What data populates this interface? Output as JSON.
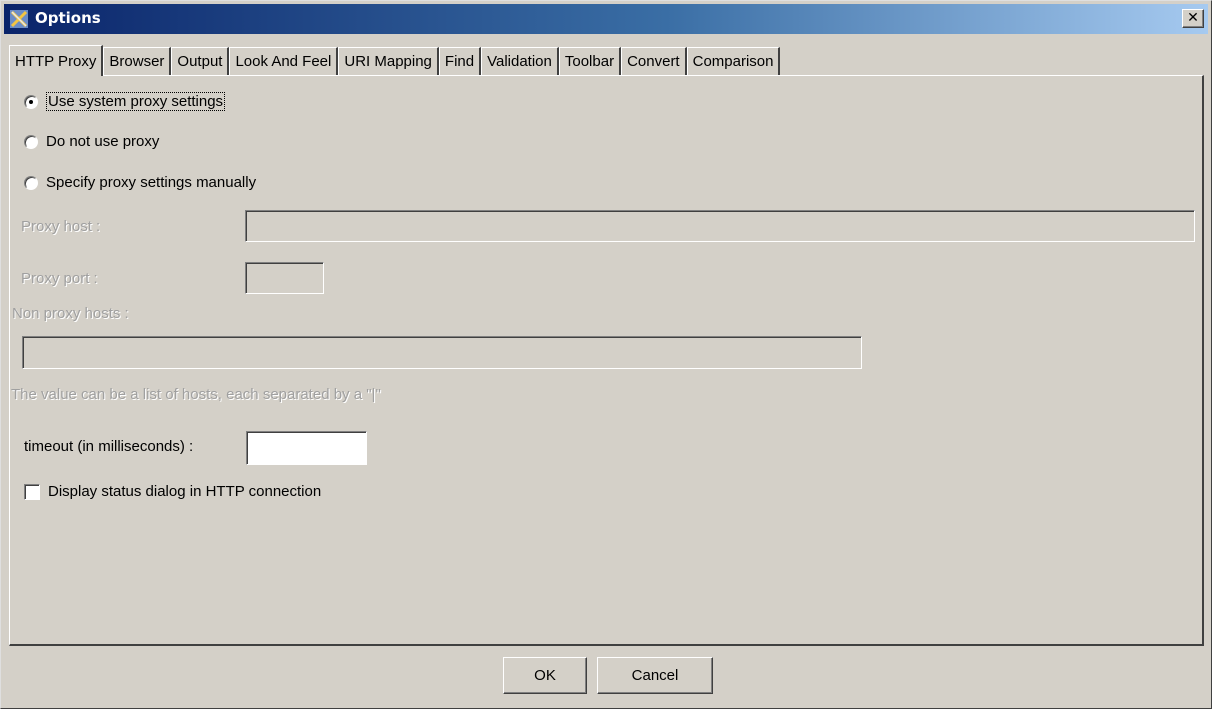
{
  "window": {
    "title": "Options",
    "close_glyph": "✕"
  },
  "tabs": [
    {
      "label": "HTTP Proxy",
      "active": true
    },
    {
      "label": "Browser"
    },
    {
      "label": "Output"
    },
    {
      "label": "Look And Feel"
    },
    {
      "label": "URI Mapping"
    },
    {
      "label": "Find"
    },
    {
      "label": "Validation"
    },
    {
      "label": "Toolbar"
    },
    {
      "label": "Convert"
    },
    {
      "label": "Comparison"
    }
  ],
  "proxy": {
    "options": [
      {
        "label": "Use system proxy settings",
        "selected": true
      },
      {
        "label": "Do not use proxy",
        "selected": false
      },
      {
        "label": "Specify proxy settings manually",
        "selected": false
      }
    ],
    "host_label": "Proxy host :",
    "host_value": "",
    "port_label": "Proxy port :",
    "port_value": "",
    "non_proxy_label": "Non proxy hosts :",
    "non_proxy_value": "",
    "hint": "The value can be a list of hosts, each separated by a \"|\"",
    "timeout_label": "timeout (in milliseconds) :",
    "timeout_value": "",
    "status_dialog_label": "Display status dialog in HTTP connection",
    "status_dialog_checked": false
  },
  "buttons": {
    "ok": "OK",
    "cancel": "Cancel"
  }
}
